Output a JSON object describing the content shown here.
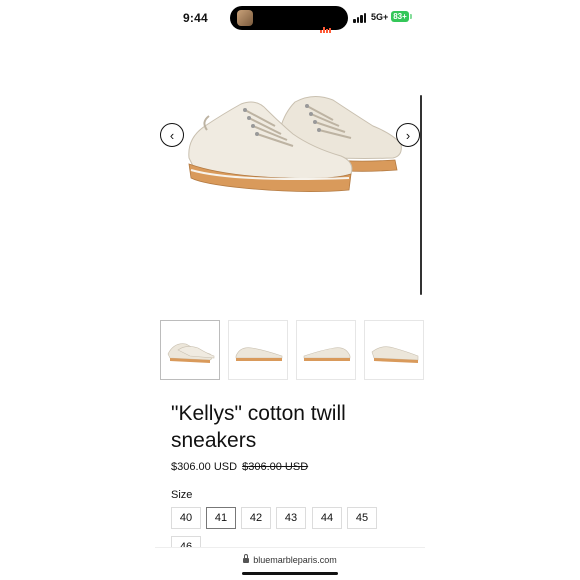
{
  "status_bar": {
    "time": "9:44",
    "network": "5G+",
    "battery": "83+"
  },
  "gallery": {
    "prev_icon": "chevron-left-icon",
    "next_icon": "chevron-right-icon",
    "prev_glyph": "‹",
    "next_glyph": "›"
  },
  "thumbnails": [
    {
      "view": "pair-angled",
      "active": true
    },
    {
      "view": "side-profile",
      "active": false
    },
    {
      "view": "side-profile-reverse",
      "active": false
    },
    {
      "view": "pair-top",
      "active": false
    }
  ],
  "product": {
    "title": "\"Kellys\" cotton twill sneakers",
    "price": "$306.00 USD",
    "compare_price": "$306.00 USD"
  },
  "size": {
    "label": "Size",
    "options": [
      "40",
      "41",
      "42",
      "43",
      "44",
      "45",
      "46"
    ],
    "selected": "41"
  },
  "browser": {
    "url": "bluemarbleparis.com"
  },
  "colors": {
    "battery": "#34c759",
    "sole": "#d99a5b",
    "upper": "#ece6da"
  }
}
